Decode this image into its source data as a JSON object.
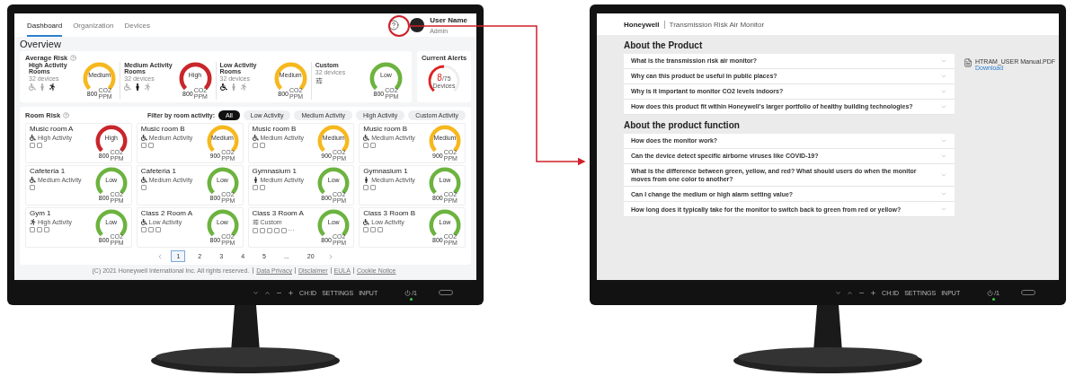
{
  "dashboard_screen": {
    "nav": {
      "tabs": [
        {
          "label": "Dashboard",
          "selected": true
        },
        {
          "label": "Organization",
          "selected": false
        },
        {
          "label": "Devices",
          "selected": false
        }
      ],
      "user": {
        "name": "User Name",
        "role": "Admin"
      }
    },
    "title": "Overview",
    "average_risk": {
      "title": "Average Risk",
      "groups": [
        {
          "name": "High Activity Rooms",
          "devices": "32 devices",
          "kind": "activity",
          "figures": [
            {
              "kind": "sitting",
              "highlighted": false
            },
            {
              "kind": "standing",
              "highlighted": false
            },
            {
              "kind": "running",
              "highlighted": true
            }
          ],
          "gauge": {
            "label": "Medium",
            "color": "#f6b81e",
            "value": "800",
            "unit": "CO2",
            "unit2": "PPM"
          }
        },
        {
          "name": "Medium Activity Rooms",
          "devices": "32 devices",
          "kind": "activity",
          "figures": [
            {
              "kind": "sitting",
              "highlighted": false
            },
            {
              "kind": "standing",
              "highlighted": true
            },
            {
              "kind": "running",
              "highlighted": false
            }
          ],
          "gauge": {
            "label": "High",
            "color": "#c8262b",
            "value": "800",
            "unit": "CO2",
            "unit2": "PPM"
          }
        },
        {
          "name": "Low Activity Rooms",
          "devices": "32 devices",
          "kind": "activity",
          "figures": [
            {
              "kind": "sitting",
              "highlighted": true
            },
            {
              "kind": "standing",
              "highlighted": false
            },
            {
              "kind": "running",
              "highlighted": false
            }
          ],
          "gauge": {
            "label": "Medium",
            "color": "#f6b81e",
            "value": "800",
            "unit": "CO2",
            "unit2": "PPM"
          }
        },
        {
          "name": "Custom",
          "devices": "32 devices",
          "kind": "custom",
          "gauge": {
            "label": "Low",
            "color": "#6cb33f",
            "value": "800",
            "unit": "CO2",
            "unit2": "PPM"
          }
        }
      ]
    },
    "current_alerts": {
      "title": "Current Alerts",
      "count": "8",
      "total": "/75",
      "label": "Devices",
      "level": 0.5
    },
    "room_risk": {
      "title": "Room Risk",
      "filter_label": "Filter by room activity:",
      "filters": [
        {
          "label": "All",
          "selected": true
        },
        {
          "label": "Low Activity",
          "selected": false
        },
        {
          "label": "Medium Activity",
          "selected": false
        },
        {
          "label": "High Activity",
          "selected": false
        },
        {
          "label": "Custom Activity",
          "selected": false
        }
      ],
      "rooms": [
        {
          "name": "Music room A",
          "activity": "High Activity",
          "kind": "sitting",
          "devices": [
            {
              "kind": "sensor"
            },
            {
              "kind": "sensor"
            }
          ],
          "gauge": {
            "label": "High",
            "color": "#c8262b",
            "value": "800",
            "unit": "CO2",
            "unit2": "PPM"
          }
        },
        {
          "name": "Music room B",
          "activity": "Medium Activity",
          "kind": "sitting",
          "devices": [
            {
              "kind": "sensor"
            },
            {
              "kind": "sensor"
            }
          ],
          "gauge": {
            "label": "Medium",
            "color": "#f6b81e",
            "value": "900",
            "unit": "CO2",
            "unit2": "PPM"
          }
        },
        {
          "name": "Music room B",
          "activity": "Medium Activity",
          "kind": "sitting",
          "devices": [
            {
              "kind": "sensor"
            },
            {
              "kind": "sensor"
            }
          ],
          "gauge": {
            "label": "Medium",
            "color": "#f6b81e",
            "value": "900",
            "unit": "CO2",
            "unit2": "PPM"
          }
        },
        {
          "name": "Music room B",
          "activity": "Medium Activity",
          "kind": "sitting",
          "devices": [
            {
              "kind": "sensor"
            },
            {
              "kind": "sensor"
            }
          ],
          "gauge": {
            "label": "Medium",
            "color": "#f6b81e",
            "value": "900",
            "unit": "CO2",
            "unit2": "PPM"
          }
        },
        {
          "name": "Cafeteria 1",
          "activity": "Medium Activity",
          "kind": "sitting",
          "devices": [
            {
              "kind": "sensor"
            }
          ],
          "gauge": {
            "label": "Low",
            "color": "#6cb33f",
            "value": "800",
            "unit": "CO2",
            "unit2": "PPM"
          }
        },
        {
          "name": "Cafeteria 1",
          "activity": "Medium Activity",
          "kind": "sitting",
          "devices": [
            {
              "kind": "sensor"
            }
          ],
          "gauge": {
            "label": "Low",
            "color": "#6cb33f",
            "value": "800",
            "unit": "CO2",
            "unit2": "PPM"
          }
        },
        {
          "name": "Gymnasium  1",
          "activity": "Medium Activity",
          "kind": "standing",
          "devices": [
            {
              "kind": "sensor"
            },
            {
              "kind": "sensor"
            }
          ],
          "gauge": {
            "label": "Low",
            "color": "#6cb33f",
            "value": "800",
            "unit": "CO2",
            "unit2": "PPM"
          }
        },
        {
          "name": "Gymnasium  1",
          "activity": "Medium Activity",
          "kind": "standing",
          "devices": [
            {
              "kind": "sensor"
            },
            {
              "kind": "sensor"
            }
          ],
          "gauge": {
            "label": "Low",
            "color": "#6cb33f",
            "value": "800",
            "unit": "CO2",
            "unit2": "PPM"
          }
        },
        {
          "name": "Gym 1",
          "activity": "High Activity",
          "kind": "running",
          "devices": [
            {
              "kind": "sensor"
            },
            {
              "kind": "sensor"
            },
            {
              "kind": "sensor"
            }
          ],
          "gauge": {
            "label": "Low",
            "color": "#6cb33f",
            "value": "800",
            "unit": "CO2",
            "unit2": "PPM"
          }
        },
        {
          "name": "Class 2 Room A",
          "activity": "Low Activity",
          "kind": "sitting",
          "devices": [
            {
              "kind": "sensor"
            },
            {
              "kind": "sensor"
            },
            {
              "kind": "sensor"
            }
          ],
          "gauge": {
            "label": "Low",
            "color": "#6cb33f",
            "value": "800",
            "unit": "CO2",
            "unit2": "PPM"
          }
        },
        {
          "name": "Class 3 Room A",
          "activity": "Custom",
          "kind": "custom",
          "devices": [
            {
              "kind": "sensor"
            },
            {
              "kind": "sensor"
            },
            {
              "kind": "sensor"
            },
            {
              "kind": "sensor"
            },
            {
              "kind": "sensor"
            }
          ],
          "more": "···",
          "gauge": {
            "label": "Low",
            "color": "#6cb33f",
            "value": "800",
            "unit": "CO2",
            "unit2": "PPM"
          }
        },
        {
          "name": "Class 3 Room B",
          "activity": "Low Activity",
          "kind": "sitting",
          "devices": [
            {
              "kind": "sensor"
            },
            {
              "kind": "sensor"
            },
            {
              "kind": "sensor"
            }
          ],
          "gauge": {
            "label": "Low",
            "color": "#6cb33f",
            "value": "800",
            "unit": "CO2",
            "unit2": "PPM"
          }
        }
      ],
      "pagination": [
        {
          "label": "1",
          "kind": "page",
          "selected": true
        },
        {
          "label": "2",
          "kind": "page",
          "selected": false
        },
        {
          "label": "3",
          "kind": "page",
          "selected": false
        },
        {
          "label": "4",
          "kind": "page",
          "selected": false
        },
        {
          "label": "5",
          "kind": "page",
          "selected": false
        },
        {
          "label": "...",
          "kind": "ellipsis"
        },
        {
          "label": "20",
          "kind": "page",
          "selected": false
        }
      ]
    },
    "footer": {
      "copyright": "(C) 2021 Honeywell International Inc. All rights reserved.",
      "links": [
        "Data Privacy",
        "Disclaimer",
        "EULA",
        "Cookie Notice"
      ]
    }
  },
  "faq_screen": {
    "brand": "Honeywell",
    "app_title": "Transmission Risk Air Monitor",
    "sections": [
      {
        "title": "About the Product",
        "questions": [
          "What is the transmission risk air monitor?",
          "Why can this product be useful in public places?",
          "Why is it important to monitor CO2 levels indoors?",
          "How does this product fit within Honeywell's larger portfolio of healthy building technologies?"
        ]
      },
      {
        "title": "About the product function",
        "questions": [
          "How does the monitor work?",
          "Can the device detect specific airborne viruses like COVID-19?",
          "What is the difference between green, yellow, and red? What should users do when the monitor moves from one color to another?",
          "Can I change the medium or high alarm setting value?",
          "How long does it typically take for the monitor to switch back to green from red or yellow?"
        ]
      }
    ],
    "attachment": {
      "file": "HTRAM_USER Manual.PDF",
      "action": "Download"
    }
  },
  "monitors": [
    {
      "controls": [
        "CH:ID",
        "SETTINGS",
        "INPUT"
      ],
      "power": "/1"
    },
    {
      "controls": [
        "CH:ID",
        "SETTINGS",
        "INPUT"
      ],
      "power": "/1"
    }
  ]
}
